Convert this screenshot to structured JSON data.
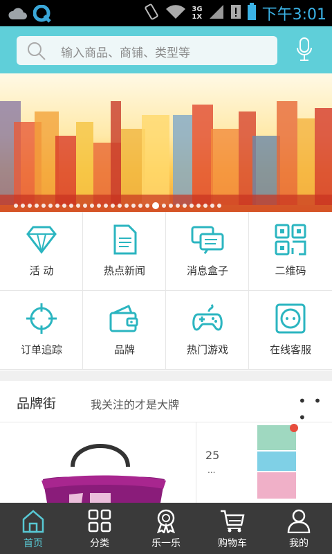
{
  "status_bar": {
    "network_top": "3G",
    "network_bottom": "1X",
    "clock": "下午3:01"
  },
  "search": {
    "placeholder": "输入商品、商铺、类型等",
    "mic_icon": "microphone-icon",
    "search_icon": "search-icon"
  },
  "banner": {
    "slide_count": 30,
    "active_index": 20
  },
  "grid": {
    "items": [
      {
        "label": "活 动",
        "icon": "diamond-icon"
      },
      {
        "label": "热点新闻",
        "icon": "document-icon"
      },
      {
        "label": "消息盒子",
        "icon": "chat-bubbles-icon"
      },
      {
        "label": "二维码",
        "icon": "qrcode-icon"
      },
      {
        "label": "订单追踪",
        "icon": "crosshair-icon"
      },
      {
        "label": "品牌",
        "icon": "wallet-icon"
      },
      {
        "label": "热门游戏",
        "icon": "gamepad-icon"
      },
      {
        "label": "在线客服",
        "icon": "service-icon"
      }
    ]
  },
  "brand_street": {
    "title": "品牌街",
    "subtitle": "我关注的才是大牌",
    "more": "• • •",
    "count": "25",
    "ellipsis": "..."
  },
  "bottom_nav": {
    "items": [
      {
        "label": "首页",
        "icon": "home-icon",
        "active": true
      },
      {
        "label": "分类",
        "icon": "grid-icon",
        "active": false
      },
      {
        "label": "乐一乐",
        "icon": "medal-icon",
        "active": false
      },
      {
        "label": "购物车",
        "icon": "cart-icon",
        "active": false
      },
      {
        "label": "我的",
        "icon": "user-icon",
        "active": false
      }
    ]
  },
  "colors": {
    "accent": "#5fcfd9",
    "icon": "#2bb5c0",
    "status_text": "#3bb3e6",
    "nav_bg": "#3a3a3a"
  }
}
